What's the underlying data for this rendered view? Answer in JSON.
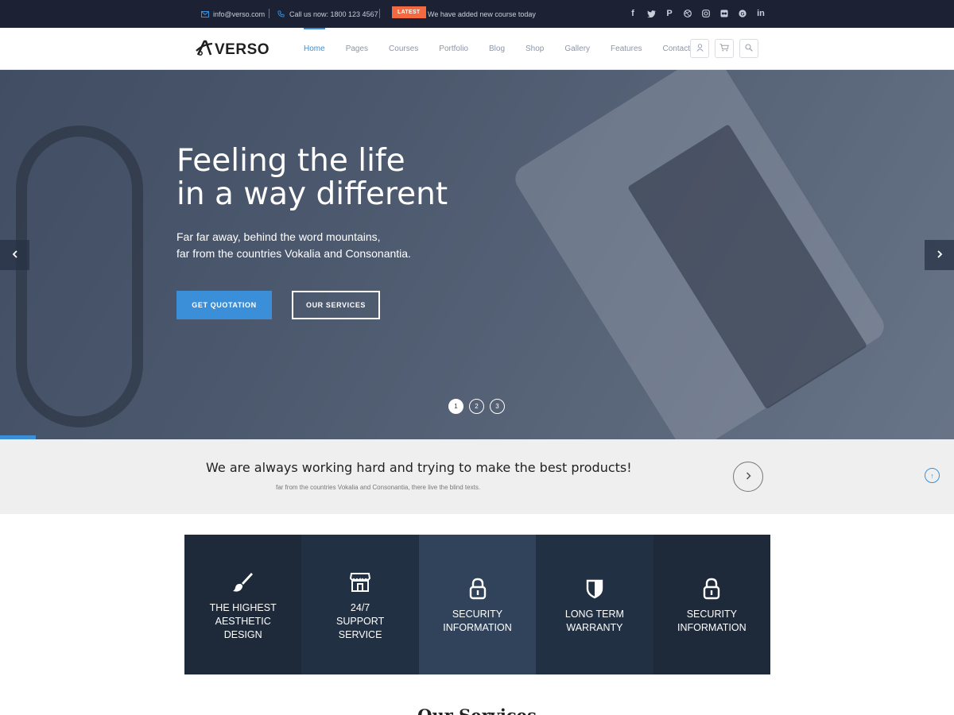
{
  "topbar": {
    "email": "info@verso.com",
    "phone": "Call us now: 1800 123 4567",
    "badge": "LATEST",
    "news": "We have added new course today",
    "socials": [
      "facebook-icon",
      "twitter-icon",
      "pinterest-icon",
      "dribbble-icon",
      "instagram-icon",
      "flickr-icon",
      "google-icon",
      "linkedin-icon"
    ]
  },
  "brand": {
    "name": "VERSO"
  },
  "nav": {
    "items": [
      "Home",
      "Pages",
      "Courses",
      "Portfolio",
      "Blog",
      "Shop",
      "Gallery",
      "Features",
      "Contact"
    ],
    "active": "Home"
  },
  "hero": {
    "title_line1": "Feeling the life",
    "title_line2": "in a way different",
    "text_line1": "Far far away, behind the word mountains,",
    "text_line2": "far from the countries Vokalia and Consonantia.",
    "btn_primary": "GET QUOTATION",
    "btn_secondary": "OUR SERVICES",
    "slides": [
      "1",
      "2",
      "3"
    ],
    "active_slide": 1
  },
  "band": {
    "headline": "We are always working hard and trying to make the best products!",
    "subtext": "far from the countries Vokalia and Consonantia, there live the blind texts.",
    "scroll_top": "↑"
  },
  "features": [
    {
      "icon": "brush-icon",
      "label": "THE HIGHEST\nAESTHETIC\nDESIGN",
      "bg": "#1e2a3a"
    },
    {
      "icon": "store-icon",
      "label": "24/7\nSUPPORT\nSERVICE",
      "bg": "#223043"
    },
    {
      "icon": "lock-icon",
      "label": "SECURITY\nINFORMATION",
      "bg": "#31435a"
    },
    {
      "icon": "shield-icon",
      "label": "LONG TERM\nWARRANTY",
      "bg": "#223043"
    },
    {
      "icon": "lock-icon",
      "label": "SECURITY\nINFORMATION",
      "bg": "#1e2a3a"
    }
  ],
  "section": {
    "title": "Our Services"
  },
  "colors": {
    "accent": "#3a8fd8",
    "topbar": "#1c2233",
    "latest": "#f4693f"
  }
}
